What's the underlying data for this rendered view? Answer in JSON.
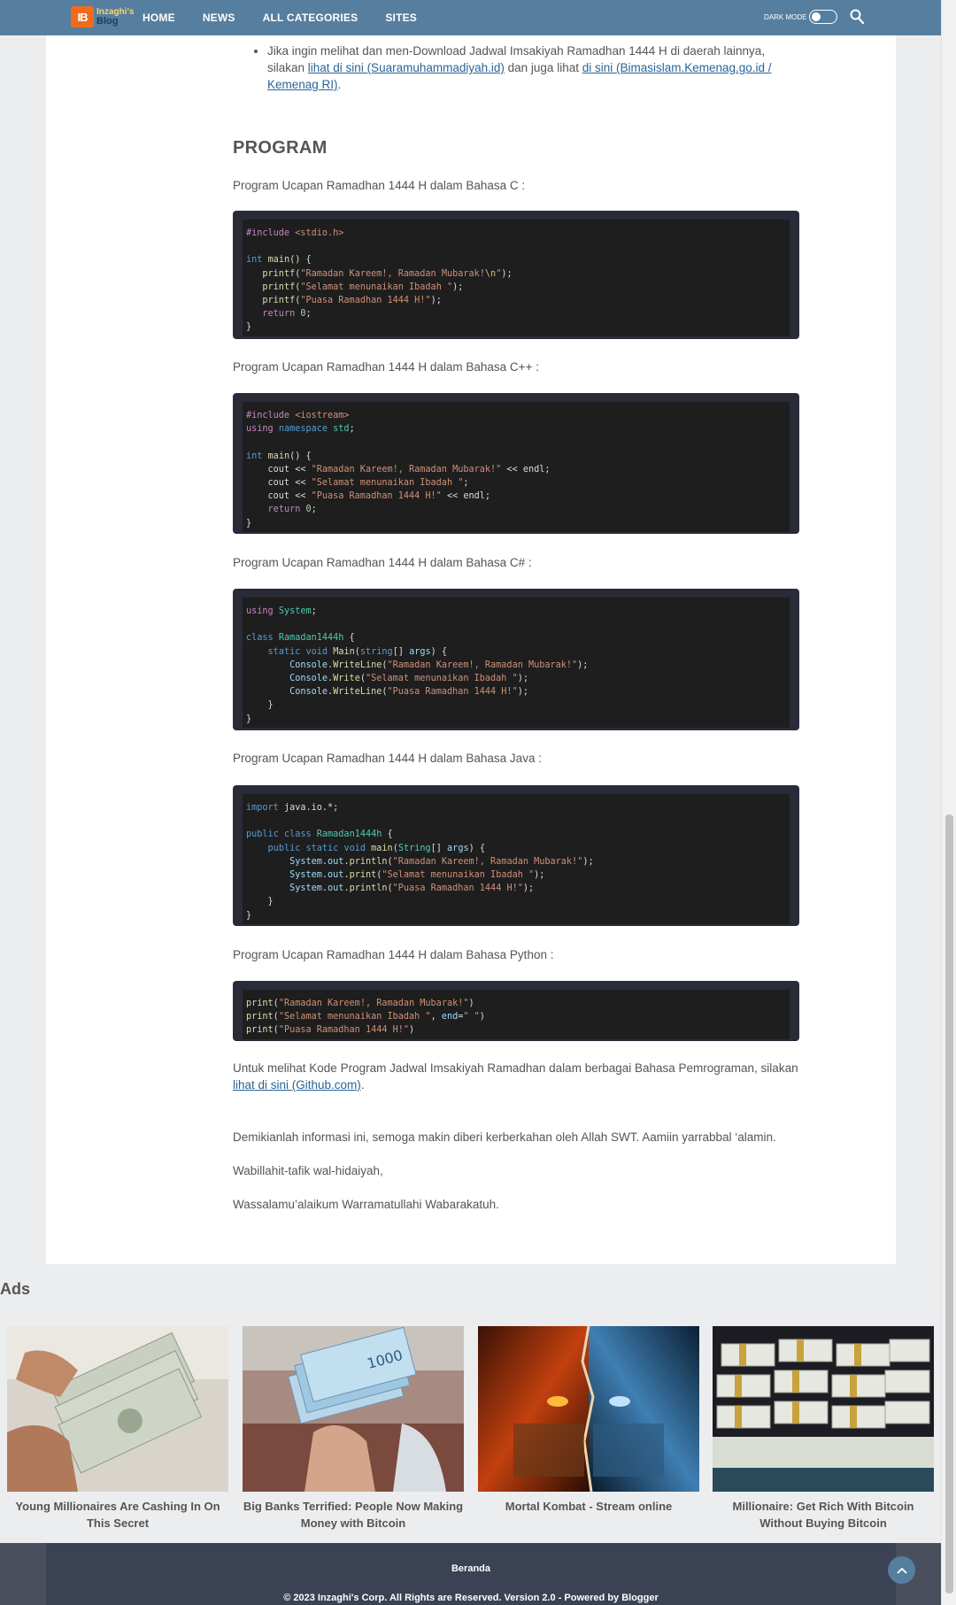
{
  "nav": {
    "logo_mark": "IB",
    "logo_line1": "Inzaghi's",
    "logo_line2": "Blog",
    "links": [
      "HOME",
      "NEWS",
      "ALL CATEGORIES",
      "SITES"
    ],
    "dark_mode_label": "DARK MODE",
    "search_icon": "search-icon"
  },
  "article": {
    "bullet": {
      "text1": "Jika ingin melihat dan men-Download Jadwal Imsakiyah Ramadhan 1444 H di daerah lainnya, silakan ",
      "link1": "lihat di sini (Suaramuhammadiyah.id)",
      "text2": " dan juga lihat ",
      "link2": "di sini (Bimasislam.Kemenag.go.id / Kemenag RI)",
      "text3": "."
    },
    "heading": "PROGRAM",
    "label_c": "Program Ucapan Ramadhan 1444 H dalam Bahasa C :",
    "label_cpp": "Program Ucapan Ramadhan 1444 H dalam Bahasa C++ :",
    "label_cs": "Program Ucapan Ramadhan 1444 H dalam Bahasa C# :",
    "label_java": "Program Ucapan Ramadhan 1444 H dalam Bahasa Java :",
    "label_python": "Program Ucapan Ramadhan 1444 H dalam Bahasa Python :",
    "code_c": "#include <stdio.h>\n\nint main() {\n   printf(\"Ramadan Kareem!, Ramadan Mubarak!\\n\");\n   printf(\"Selamat menunaikan Ibadah \");\n   printf(\"Puasa Ramadhan 1444 H!\");\n   return 0;\n}",
    "code_cpp": "#include <iostream>\nusing namespace std;\n\nint main() {\n    cout << \"Ramadan Kareem!, Ramadan Mubarak!\" << endl;\n    cout << \"Selamat menunaikan Ibadah \";\n    cout << \"Puasa Ramadhan 1444 H!\" << endl;\n    return 0;\n}",
    "code_cs": "using System;\n\nclass Ramadan1444h {\n    static void Main(string[] args) {\n        Console.WriteLine(\"Ramadan Kareem!, Ramadan Mubarak!\");\n        Console.Write(\"Selamat menunaikan Ibadah \");\n        Console.WriteLine(\"Puasa Ramadhan 1444 H!\");\n    }\n}",
    "code_java": "import java.io.*;\n\npublic class Ramadan1444h {\n    public static void main(String[] args) {\n        System.out.println(\"Ramadan Kareem!, Ramadan Mubarak!\");\n        System.out.print(\"Selamat menunaikan Ibadah \");\n        System.out.println(\"Puasa Ramadhan 1444 H!\");\n    }\n}",
    "code_python": "print(\"Ramadan Kareem!, Ramadan Mubarak!\")\nprint(\"Selamat menunaikan Ibadah \", end=\" \")\nprint(\"Puasa Ramadhan 1444 H!\")",
    "github_text": "Untuk melihat Kode Program Jadwal Imsakiyah Ramadhan dalam berbagai Bahasa Pemrograman, silakan ",
    "github_link": "lihat di sini (Github.com)",
    "github_end": ".",
    "closing1": "Demikianlah informasi ini, semoga makin diberi kerberkahan oleh Allah SWT. Aamiin yarrabbal ‘alamin.",
    "closing2": "Wabillahit-tafik wal-hidaiyah,",
    "closing3": "Wassalamu’alaikum Warramatullahi Wabarakatuh."
  },
  "ads": {
    "title": "Ads",
    "items": [
      {
        "title": "Young Millionaires Are Cashing In On This Secret"
      },
      {
        "title": "Big Banks Terrified: People Now Making Money with Bitcoin"
      },
      {
        "title": "Mortal Kombat - Stream online"
      },
      {
        "title": "Millionaire: Get Rich With Bitcoin Without Buying Bitcoin"
      }
    ]
  },
  "footer": {
    "link": "Beranda",
    "copyright": "© 2023 Inzaghi's Corp. All Rights are Reserved. Version 2.0 - Powered by Blogger"
  },
  "colors": {
    "nav": "#567e9e",
    "footer": "#3b4253",
    "link": "#2a6496",
    "code_frame": "#2a2b38",
    "code_bg": "#1e1e1e"
  }
}
